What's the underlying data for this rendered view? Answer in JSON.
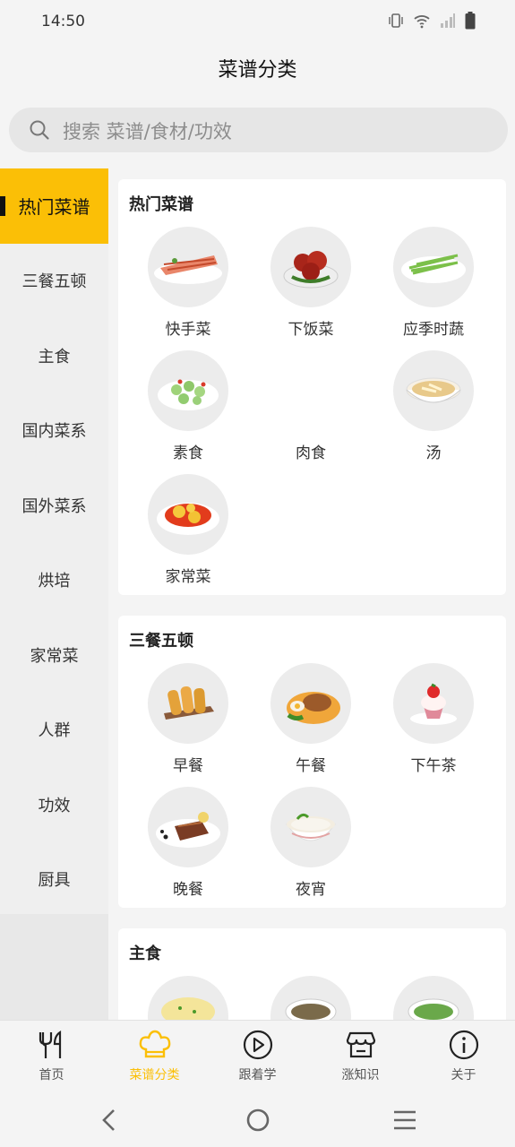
{
  "status": {
    "time": "14:50"
  },
  "header": {
    "title": "菜谱分类"
  },
  "search": {
    "placeholder": "搜索 菜谱/食材/功效"
  },
  "sidebar": {
    "items": [
      {
        "label": "热门菜谱",
        "active": true
      },
      {
        "label": "三餐五顿"
      },
      {
        "label": "主食"
      },
      {
        "label": "国内菜系"
      },
      {
        "label": "国外菜系"
      },
      {
        "label": "烘培"
      },
      {
        "label": "家常菜"
      },
      {
        "label": "人群"
      },
      {
        "label": "功效"
      },
      {
        "label": "厨具"
      }
    ]
  },
  "sections": [
    {
      "title": "热门菜谱",
      "items": [
        "快手菜",
        "下饭菜",
        "应季时蔬",
        "素食",
        "肉食",
        "汤",
        "家常菜"
      ]
    },
    {
      "title": "三餐五顿",
      "items": [
        "早餐",
        "午餐",
        "下午茶",
        "晚餐",
        "夜宵"
      ]
    },
    {
      "title": "主食",
      "items": [
        "",
        "",
        ""
      ]
    }
  ],
  "tabs": [
    {
      "label": "首页",
      "icon": "fork-knife-icon"
    },
    {
      "label": "菜谱分类",
      "icon": "chef-hat-icon",
      "active": true
    },
    {
      "label": "跟着学",
      "icon": "play-circle-icon"
    },
    {
      "label": "涨知识",
      "icon": "store-icon"
    },
    {
      "label": "关于",
      "icon": "info-icon"
    }
  ],
  "colors": {
    "accent": "#fbbf06",
    "background": "#f4f4f4"
  }
}
